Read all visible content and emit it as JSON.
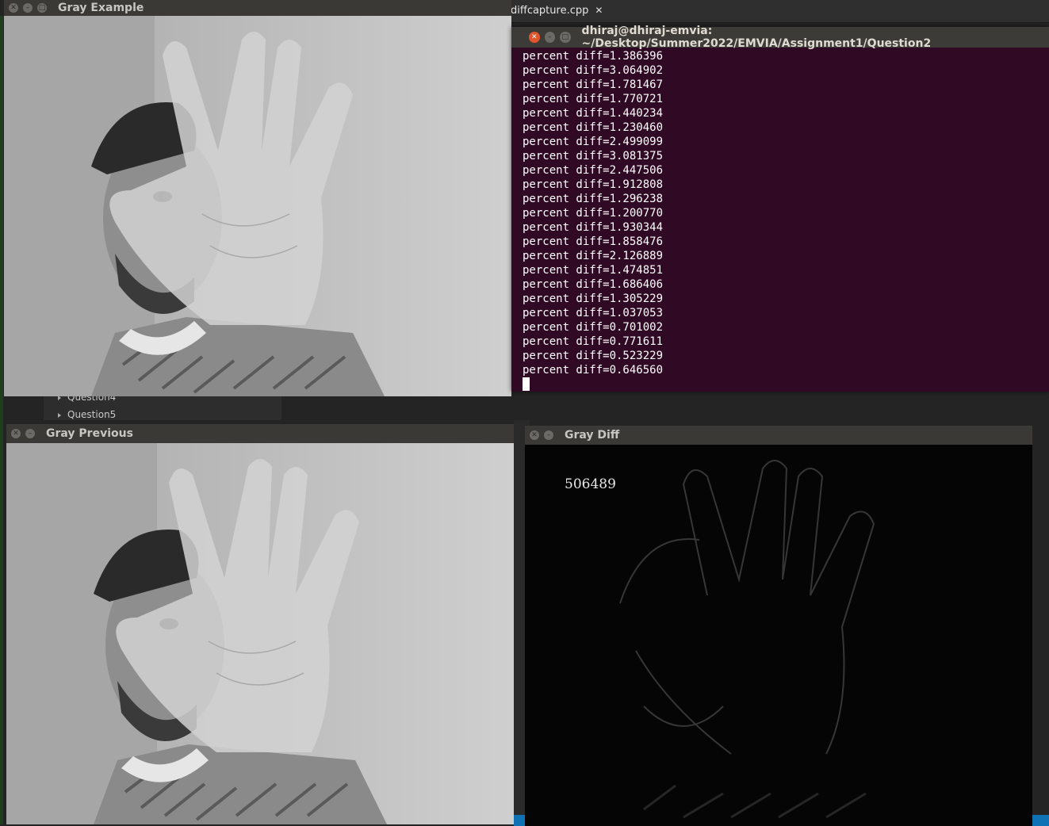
{
  "editor": {
    "tab_label": "diffcapture.cpp",
    "tab_close": "✕",
    "sidebar_items": [
      "Question4",
      "Question5"
    ]
  },
  "windows": {
    "gray_example": {
      "title": "Gray Example"
    },
    "gray_previous": {
      "title": "Gray Previous"
    },
    "gray_diff": {
      "title": "Gray Diff",
      "pixel_count": "506489"
    }
  },
  "terminal": {
    "title": "dhiraj@dhiraj-emvia: ~/Desktop/Summer2022/EMVIA/Assignment1/Question2",
    "lines": [
      "percent diff=1.386396",
      "percent diff=3.064902",
      "percent diff=1.781467",
      "percent diff=1.770721",
      "percent diff=1.440234",
      "percent diff=1.230460",
      "percent diff=2.499099",
      "percent diff=3.081375",
      "percent diff=2.447506",
      "percent diff=1.912808",
      "percent diff=1.296238",
      "percent diff=1.200770",
      "percent diff=1.930344",
      "percent diff=1.858476",
      "percent diff=2.126889",
      "percent diff=1.474851",
      "percent diff=1.686406",
      "percent diff=1.305229",
      "percent diff=1.037053",
      "percent diff=0.701002",
      "percent diff=0.771611",
      "percent diff=0.523229",
      "percent diff=0.646560"
    ]
  },
  "icons": {
    "close": "close-icon",
    "minimize": "minimize-icon",
    "maximize": "maximize-icon"
  }
}
